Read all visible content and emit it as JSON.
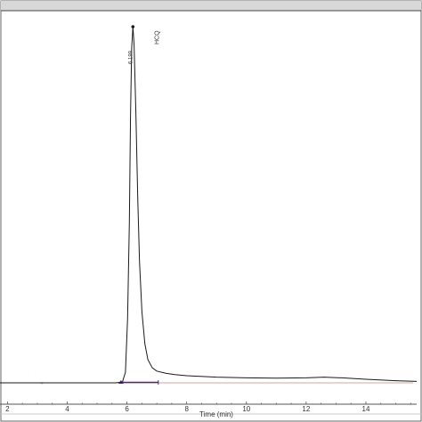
{
  "chart_data": {
    "type": "line",
    "title": "",
    "xlabel": "Time (min)",
    "ylabel": "",
    "xlim": [
      1.75,
      15.7
    ],
    "ylim": [
      0,
      100
    ],
    "grid": false,
    "x_ticks": [
      "2",
      "4",
      "6",
      "8",
      "10",
      "12",
      "14"
    ],
    "x_tick_values": [
      2,
      4,
      6,
      8,
      10,
      12,
      14
    ],
    "peak": {
      "retention_time_label": "6.199",
      "retention_time": 6.2,
      "compound_label": "HCQ",
      "height": 100
    },
    "series": [
      {
        "x": [
          1.75,
          5.6,
          5.85,
          5.95,
          6.02,
          6.08,
          6.12,
          6.16,
          6.2,
          6.24,
          6.3,
          6.36,
          6.42,
          6.5,
          6.6,
          6.7,
          6.85,
          7.0,
          7.3,
          7.6,
          8.0,
          9.0,
          10.0,
          11.0,
          12.0,
          12.6,
          13.2,
          14.0,
          15.0,
          15.7
        ],
        "y": [
          0,
          0,
          0.2,
          3,
          18,
          45,
          75,
          94,
          100,
          95,
          76,
          52,
          34,
          20,
          11,
          6.5,
          4.2,
          3.3,
          2.7,
          2.3,
          2.0,
          1.6,
          1.4,
          1.3,
          1.4,
          1.6,
          1.4,
          1.0,
          0.6,
          0.4
        ]
      }
    ],
    "baseline": {
      "x": [
        5.8,
        7.05
      ]
    },
    "colors": {
      "trace": "#1a1a1a",
      "baseline": "#4b2a7a",
      "reference": "#c98a7a",
      "frame": "#555555"
    }
  }
}
